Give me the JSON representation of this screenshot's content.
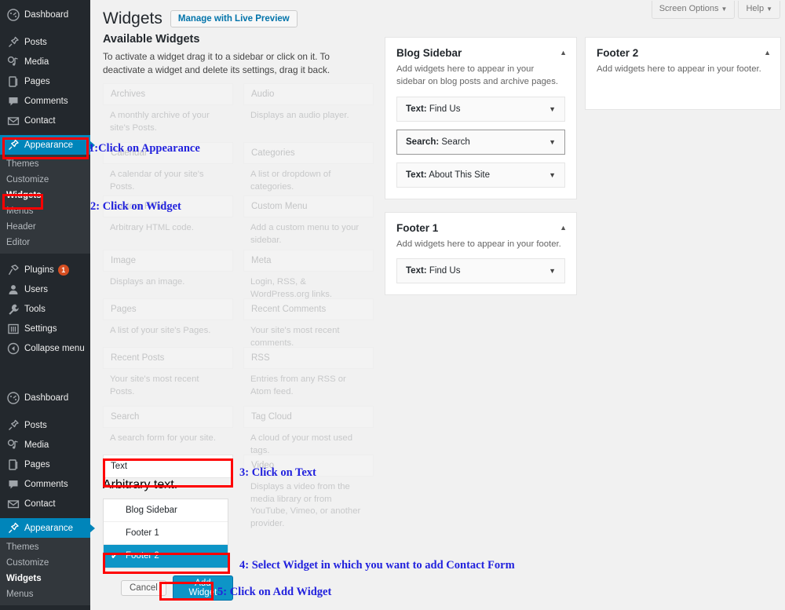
{
  "sidebar": {
    "group1": [
      {
        "label": "Dashboard",
        "icon": "dashboard-icon"
      },
      {
        "label": "Posts",
        "icon": "pin-icon"
      },
      {
        "label": "Media",
        "icon": "media-icon"
      },
      {
        "label": "Pages",
        "icon": "page-icon"
      },
      {
        "label": "Comments",
        "icon": "comment-icon"
      },
      {
        "label": "Contact",
        "icon": "envelope-icon"
      },
      {
        "label": "Appearance",
        "icon": "brush-icon",
        "current": true
      }
    ],
    "appearance_submenu": [
      {
        "label": "Themes"
      },
      {
        "label": "Customize"
      },
      {
        "label": "Widgets",
        "current": true
      },
      {
        "label": "Menus"
      },
      {
        "label": "Header"
      },
      {
        "label": "Editor"
      }
    ],
    "group2": [
      {
        "label": "Plugins",
        "icon": "plug-icon",
        "badge": "1"
      },
      {
        "label": "Users",
        "icon": "user-icon"
      },
      {
        "label": "Tools",
        "icon": "wrench-icon"
      },
      {
        "label": "Settings",
        "icon": "settings-icon"
      },
      {
        "label": "Collapse menu",
        "icon": "collapse-icon"
      }
    ],
    "group3": [
      {
        "label": "Dashboard",
        "icon": "dashboard-icon"
      },
      {
        "label": "Posts",
        "icon": "pin-icon"
      },
      {
        "label": "Media",
        "icon": "media-icon"
      },
      {
        "label": "Pages",
        "icon": "page-icon"
      },
      {
        "label": "Comments",
        "icon": "comment-icon"
      },
      {
        "label": "Contact",
        "icon": "envelope-icon"
      },
      {
        "label": "Appearance",
        "icon": "brush-icon",
        "current": true
      }
    ],
    "appearance_submenu2": [
      {
        "label": "Themes"
      },
      {
        "label": "Customize"
      },
      {
        "label": "Widgets",
        "current": true
      },
      {
        "label": "Menus"
      }
    ]
  },
  "screen_meta": {
    "screen_options": "Screen Options",
    "help": "Help",
    "caret": "▼"
  },
  "header": {
    "title": "Widgets",
    "live_preview": "Manage with Live Preview"
  },
  "available": {
    "heading": "Available Widgets",
    "description": "To activate a widget drag it to a sidebar or click on it. To deactivate a widget and delete its settings, drag it back.",
    "widgets": [
      {
        "name": "Archives",
        "desc": "A monthly archive of your site's Posts."
      },
      {
        "name": "Audio",
        "desc": "Displays an audio player."
      },
      {
        "name": "Calendar",
        "desc": "A calendar of your site's Posts."
      },
      {
        "name": "Categories",
        "desc": "A list or dropdown of categories."
      },
      {
        "name": "Custom HTML",
        "desc": "Arbitrary HTML code."
      },
      {
        "name": "Custom Menu",
        "desc": "Add a custom menu to your sidebar."
      },
      {
        "name": "Image",
        "desc": "Displays an image."
      },
      {
        "name": "Meta",
        "desc": "Login, RSS, & WordPress.org links."
      },
      {
        "name": "Pages",
        "desc": "A list of your site's Pages."
      },
      {
        "name": "Recent Comments",
        "desc": "Your site's most recent comments."
      },
      {
        "name": "Recent Posts",
        "desc": "Your site's most recent Posts."
      },
      {
        "name": "RSS",
        "desc": "Entries from any RSS or Atom feed."
      },
      {
        "name": "Search",
        "desc": "A search form for your site."
      },
      {
        "name": "Tag Cloud",
        "desc": "A cloud of your most used tags."
      },
      {
        "name": "Video",
        "desc": "Displays a video from the media library or from YouTube, Vimeo, or another provider."
      }
    ],
    "text_widget": {
      "name": "Text",
      "desc": "Arbitrary text.",
      "options": [
        {
          "label": "Blog Sidebar",
          "selected": false
        },
        {
          "label": "Footer 1",
          "selected": false
        },
        {
          "label": "Footer 2",
          "selected": true
        }
      ],
      "check_glyph": "✔",
      "cancel": "Cancel",
      "add_widget": "Add Widget"
    }
  },
  "sidebars": [
    {
      "title": "Blog Sidebar",
      "desc": "Add widgets here to appear in your sidebar on blog posts and archive pages.",
      "toggle": "▲",
      "widgets": [
        {
          "prefix": "Text:",
          "name": "Find Us",
          "focused": false
        },
        {
          "prefix": "Search:",
          "name": "Search",
          "focused": true
        },
        {
          "prefix": "Text:",
          "name": "About This Site",
          "focused": false
        }
      ]
    },
    {
      "title": "Footer 1",
      "desc": "Add widgets here to appear in your footer.",
      "toggle": "▲",
      "widgets": [
        {
          "prefix": "Text:",
          "name": "Find Us",
          "focused": false
        }
      ]
    },
    {
      "title": "Footer 2",
      "desc": "Add widgets here to appear in your footer.",
      "toggle": "▲",
      "widgets": []
    }
  ],
  "annotations": [
    {
      "id": "a1",
      "text": "1:Click on Appearance"
    },
    {
      "id": "a2",
      "text": "2: Click on Widget"
    },
    {
      "id": "a3",
      "text": "3: Click on Text"
    },
    {
      "id": "a4",
      "text": "4: Select Widget in which you want to add Contact Form"
    },
    {
      "id": "a5",
      "text": "5: Click on Add Widget"
    }
  ],
  "colors": {
    "admin_bg": "#23282d",
    "accent": "#0085ba",
    "highlight_red": "#ff0000",
    "annotation_blue": "#2222dd",
    "badge": "#d54e21"
  }
}
